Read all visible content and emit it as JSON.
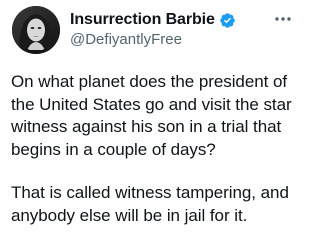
{
  "tweet": {
    "display_name": "Insurrection Barbie",
    "handle": "@DefiyantlyFree",
    "verified": true,
    "paragraphs": [
      "On what planet does the president of the United States go and visit the star witness against his son in a trial that begins in a couple of days?",
      "That is called witness tampering, and anybody else will be in jail for it."
    ]
  },
  "icons": {
    "verified": "verified-badge-icon",
    "more": "more-options-icon",
    "avatar": "profile-avatar"
  },
  "colors": {
    "verified_blue": "#1d9bf0",
    "text_primary": "#0f1419",
    "text_secondary": "#536471"
  }
}
